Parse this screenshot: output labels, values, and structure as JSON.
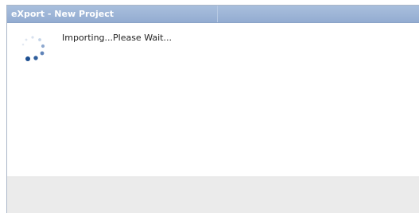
{
  "window": {
    "title": "eXport - New Project"
  },
  "dialog": {
    "message": "Importing...Please Wait..."
  },
  "icons": {
    "spinner": "loading-spinner-icon"
  },
  "colors": {
    "titlebar": "#a9bfdd",
    "spinner_dark": "#1d4f91",
    "spinner_light": "#b9cbe4",
    "footer": "#ebebeb"
  }
}
